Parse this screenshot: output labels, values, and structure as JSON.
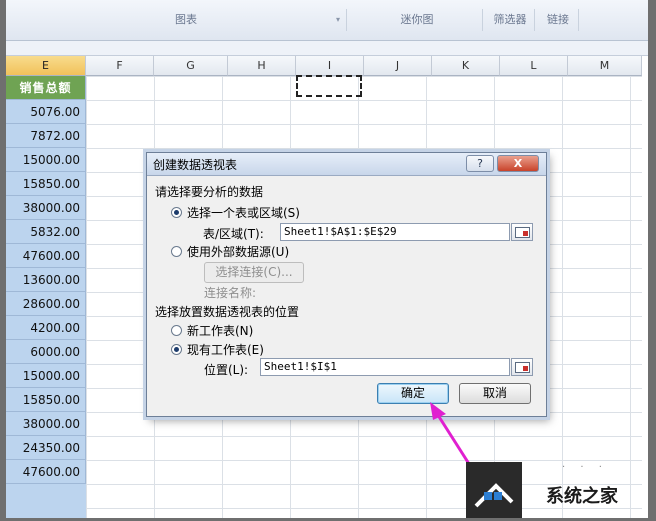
{
  "ribbon": {
    "groups": [
      {
        "label": "图表"
      },
      {
        "label": "迷你图"
      },
      {
        "label": "筛选器"
      },
      {
        "label": "链接"
      }
    ]
  },
  "sheet": {
    "columns": [
      "E",
      "F",
      "G",
      "H",
      "I",
      "J",
      "K",
      "L",
      "M"
    ],
    "selected_column": "E",
    "column_e_header": "销售总额",
    "column_e_values": [
      "5076.00",
      "7872.00",
      "15000.00",
      "15850.00",
      "38000.00",
      "5832.00",
      "47600.00",
      "13600.00",
      "28600.00",
      "4200.00",
      "6000.00",
      "15000.00",
      "15850.00",
      "38000.00",
      "24350.00",
      "47600.00"
    ]
  },
  "dialog": {
    "title": "创建数据透视表",
    "help_label": "?",
    "close_label": "X",
    "section1_title": "请选择要分析的数据",
    "opt_select_range": "选择一个表或区域(S)",
    "table_range_label": "表/区域(T):",
    "table_range_value": "Sheet1!$A$1:$E$29",
    "opt_external": "使用外部数据源(U)",
    "choose_connection": "选择连接(C)...",
    "connection_name_label": "连接名称:",
    "section2_title": "选择放置数据透视表的位置",
    "opt_new_sheet": "新工作表(N)",
    "opt_existing_sheet": "现有工作表(E)",
    "location_label": "位置(L):",
    "location_value": "Sheet1!$I$1",
    "ok_label": "确定",
    "cancel_label": "取消"
  },
  "colors": {
    "header_green": "#6fa353",
    "column_blue": "#bcd4ee",
    "arrow_magenta": "#e020d0"
  },
  "watermark": {
    "text": "系统之家"
  }
}
